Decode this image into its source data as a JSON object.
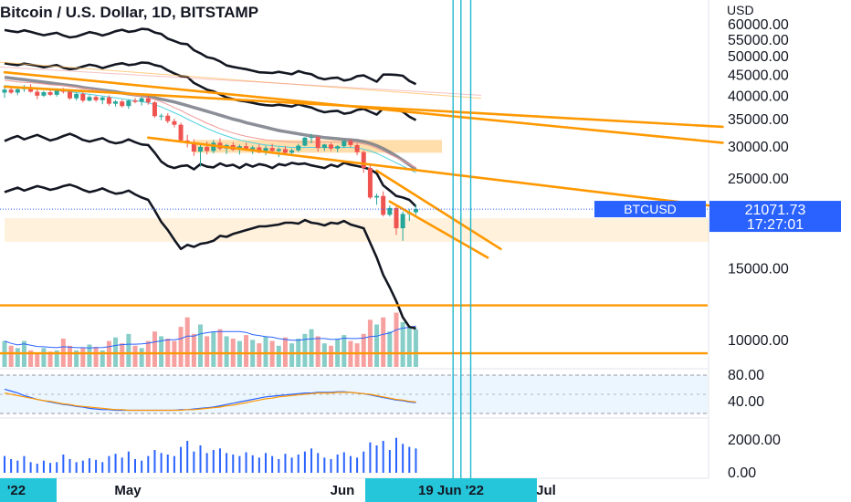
{
  "header": {
    "title": "Bitcoin / U.S. Dollar, 1D, BITSTAMP",
    "currency": "USD"
  },
  "price_tag": {
    "symbol": "BTCUSD",
    "price": "21071.73",
    "countdown": "17:27:01"
  },
  "colors": {
    "up": "#26a69a",
    "down": "#ef5350",
    "orange": "#ff9800",
    "cyan": "#22b8cf",
    "blue": "#2962ff",
    "grey": "#787b86"
  },
  "chart_data": {
    "type": "candlestick",
    "price_axis": {
      "ticks": [
        "60000.00",
        "55000.00",
        "50000.00",
        "45000.00",
        "40000.00",
        "35000.00",
        "30000.00",
        "25000.00",
        "15000.00",
        "10000.00"
      ],
      "tick_values": [
        60000,
        55000,
        50000,
        45000,
        40000,
        35000,
        30000,
        25000,
        15000,
        10000
      ]
    },
    "oscillator_axis": {
      "ticks": [
        "80.00",
        "40.00"
      ],
      "tick_values": [
        80,
        40
      ]
    },
    "volume_axis": {
      "ticks": [
        "2000.00",
        "0.00"
      ],
      "tick_values": [
        2000,
        0
      ]
    },
    "x_axis": {
      "labels": [
        "'22",
        "May",
        "Jun",
        "19 Jun '22",
        "Jul"
      ]
    },
    "candles_ohlc": [
      [
        40800,
        42200,
        39600,
        41500
      ],
      [
        41500,
        41900,
        40500,
        40800
      ],
      [
        40800,
        41800,
        40200,
        41600
      ],
      [
        41600,
        42600,
        41000,
        42100
      ],
      [
        42100,
        42800,
        40800,
        41000
      ],
      [
        41000,
        41600,
        39300,
        40100
      ],
      [
        40100,
        41200,
        39800,
        40900
      ],
      [
        40900,
        41400,
        40000,
        40300
      ],
      [
        40300,
        41800,
        39900,
        41400
      ],
      [
        41400,
        41900,
        40600,
        41000
      ],
      [
        41000,
        41300,
        39200,
        39500
      ],
      [
        39500,
        40800,
        39000,
        40500
      ],
      [
        40500,
        40900,
        38600,
        39000
      ],
      [
        39000,
        40200,
        38800,
        39800
      ],
      [
        39800,
        40100,
        38700,
        39100
      ],
      [
        39100,
        39900,
        38200,
        39700
      ],
      [
        39700,
        40200,
        37900,
        38300
      ],
      [
        38300,
        39100,
        37700,
        38800
      ],
      [
        38800,
        39200,
        37500,
        37800
      ],
      [
        37800,
        39300,
        37200,
        39000
      ],
      [
        39000,
        39600,
        38400,
        38700
      ],
      [
        38700,
        39900,
        37900,
        39500
      ],
      [
        39500,
        40100,
        38100,
        38600
      ],
      [
        38600,
        38900,
        35400,
        35700
      ],
      [
        35700,
        36200,
        34900,
        35800
      ],
      [
        35800,
        36300,
        34300,
        34700
      ],
      [
        34700,
        35200,
        33500,
        34000
      ],
      [
        34000,
        34400,
        30800,
        31100
      ],
      [
        31100,
        32100,
        29900,
        30600
      ],
      [
        30600,
        31300,
        28500,
        29200
      ],
      [
        29200,
        30300,
        26800,
        30000
      ],
      [
        30000,
        30900,
        28700,
        29300
      ],
      [
        29300,
        31200,
        28900,
        30700
      ],
      [
        30700,
        31500,
        29400,
        29700
      ],
      [
        29700,
        30500,
        28800,
        30300
      ],
      [
        30300,
        30800,
        29300,
        29500
      ],
      [
        29500,
        30400,
        28700,
        30100
      ],
      [
        30100,
        30700,
        29300,
        29400
      ],
      [
        29400,
        30200,
        28800,
        29900
      ],
      [
        29900,
        30400,
        28900,
        29100
      ],
      [
        29100,
        30200,
        28600,
        29800
      ],
      [
        29800,
        30500,
        29100,
        29300
      ],
      [
        29300,
        29900,
        28300,
        29600
      ],
      [
        29600,
        30100,
        28700,
        29000
      ],
      [
        29000,
        29700,
        28500,
        29400
      ],
      [
        29400,
        30500,
        29100,
        30200
      ],
      [
        30200,
        31700,
        30100,
        31600
      ],
      [
        31600,
        32300,
        30600,
        31700
      ],
      [
        31700,
        31900,
        29200,
        29800
      ],
      [
        29800,
        30500,
        29300,
        30400
      ],
      [
        30400,
        30700,
        29300,
        29700
      ],
      [
        29700,
        30300,
        29100,
        30100
      ],
      [
        30100,
        31200,
        29800,
        31000
      ],
      [
        31000,
        31400,
        29900,
        30300
      ],
      [
        30300,
        30600,
        28600,
        29100
      ],
      [
        29100,
        29400,
        25900,
        26600
      ],
      [
        26600,
        27200,
        22300,
        22500
      ],
      [
        22500,
        23000,
        21600,
        22700
      ],
      [
        22700,
        23300,
        20200,
        20400
      ],
      [
        20400,
        21500,
        20200,
        21200
      ],
      [
        21200,
        21400,
        18200,
        18900
      ],
      [
        18900,
        20800,
        17600,
        20500
      ],
      [
        20500,
        21100,
        19700,
        20700
      ],
      [
        20700,
        21600,
        20400,
        21071
      ]
    ],
    "band_series": {
      "upper_outer": [
        58200,
        57800,
        57500,
        58100,
        57600,
        57000,
        56500,
        56900,
        57300,
        56400,
        55800,
        56100,
        56800,
        57500,
        57100,
        56400,
        57000,
        57800,
        58300,
        57600,
        57900,
        58600,
        58400,
        57400,
        56900,
        55400,
        54700,
        53900,
        53700,
        51900,
        51000,
        49900,
        49500,
        48700,
        47600,
        47200,
        46900,
        46600,
        46200,
        45800,
        45700,
        45600,
        45900,
        45600,
        45300,
        46100,
        45600,
        45300,
        44400,
        44000,
        44300,
        44400,
        43700,
        44000,
        44800,
        45000,
        44200,
        43400,
        45200,
        45200,
        45100,
        44900,
        43600,
        42800
      ],
      "upper_inner": [
        48200,
        47900,
        47700,
        48100,
        47800,
        47500,
        47100,
        47400,
        47700,
        47000,
        46600,
        46800,
        47300,
        47800,
        47500,
        46900,
        47400,
        47900,
        48200,
        47700,
        47900,
        48400,
        48300,
        47700,
        47300,
        46300,
        45500,
        44800,
        44600,
        43100,
        42300,
        41500,
        41100,
        40400,
        39700,
        39300,
        39000,
        38800,
        38500,
        38200,
        38000,
        37900,
        38100,
        37900,
        37700,
        38200,
        37800,
        37500,
        36900,
        36500,
        36700,
        36800,
        36200,
        36400,
        37000,
        37200,
        36600,
        36000,
        37300,
        37200,
        37100,
        36600,
        35600,
        34900
      ],
      "lower_inner": [
        31000,
        31500,
        31900,
        31300,
        31700,
        32100,
        31600,
        31100,
        31400,
        31900,
        32300,
        31800,
        31200,
        30900,
        31200,
        31500,
        30900,
        30600,
        30800,
        31300,
        30800,
        30400,
        30300,
        29000,
        27600,
        26900,
        26600,
        26900,
        27000,
        26400,
        27200,
        26800,
        26700,
        27300,
        26900,
        27100,
        26600,
        27200,
        26800,
        27200,
        27000,
        26600,
        27200,
        27000,
        27400,
        27200,
        27300,
        27000,
        26800,
        26600,
        27100,
        26800,
        27400,
        27100,
        26900,
        26700,
        26400,
        25800,
        24100,
        23400,
        22700,
        22500,
        22200,
        21400
      ],
      "lower_outer": [
        23200,
        23500,
        23800,
        23400,
        23700,
        24000,
        23800,
        23500,
        23700,
        24000,
        24200,
        23900,
        23500,
        23200,
        23400,
        23700,
        23300,
        23000,
        23100,
        23400,
        22900,
        22500,
        22200,
        20900,
        19600,
        18700,
        17700,
        16800,
        17200,
        17000,
        17300,
        17400,
        17600,
        18100,
        18000,
        18300,
        18500,
        18700,
        18900,
        19100,
        19100,
        19200,
        19300,
        19500,
        19500,
        19400,
        19800,
        19500,
        19400,
        19200,
        19500,
        19400,
        19700,
        19300,
        19100,
        18900,
        17400,
        16000,
        14500,
        13500,
        12500,
        11400,
        10800,
        10700
      ]
    },
    "moving_averages": {
      "ma_grey": [
        44500,
        44300,
        44100,
        43900,
        43700,
        43500,
        43300,
        43100,
        42900,
        42700,
        42500,
        42300,
        42000,
        41800,
        41600,
        41400,
        41200,
        41000,
        40700,
        40500,
        40300,
        40100,
        39900,
        39600,
        39300,
        39000,
        38700,
        38300,
        37900,
        37500,
        37100,
        36700,
        36300,
        35900,
        35500,
        35100,
        34800,
        34400,
        34100,
        33800,
        33500,
        33200,
        32900,
        32700,
        32500,
        32300,
        32100,
        31900,
        31800,
        31600,
        31500,
        31400,
        31300,
        31200,
        31100,
        30900,
        30600,
        30200,
        29700,
        29100,
        28500,
        27800,
        27100,
        26400
      ],
      "ma_thin": [
        42500,
        42300,
        42100,
        42000,
        41900,
        41800,
        41600,
        41400,
        41300,
        41200,
        41000,
        40800,
        40600,
        40400,
        40200,
        40000,
        39800,
        39600,
        39400,
        39200,
        39000,
        38800,
        38500,
        38100,
        37600,
        37000,
        36400,
        35800,
        35100,
        34500,
        33900,
        33300,
        32800,
        32300,
        31900,
        31500,
        31200,
        30900,
        30700,
        30500,
        30300,
        30200,
        30100,
        30000,
        29900,
        29900,
        29900,
        29900,
        29900,
        29900,
        29900,
        29900,
        29900,
        29900,
        29800,
        29600,
        29300,
        28900,
        28400,
        27900,
        27400,
        26900,
        26400,
        25900
      ]
    },
    "trendlines": [
      {
        "from": [
          0,
          45800
        ],
        "to": [
          110,
          30700
        ]
      },
      {
        "from": [
          0,
          42200
        ],
        "to": [
          110,
          33600
        ]
      },
      {
        "from": [
          22,
          31600
        ],
        "to": [
          110,
          21300
        ]
      },
      {
        "from": [
          57,
          26200
        ],
        "to": [
          76,
          16800
        ]
      },
      {
        "from": [
          59,
          22000
        ],
        "to": [
          74,
          16000
        ]
      }
    ],
    "horizontal_levels": [
      12200,
      9300
    ],
    "zones": [
      {
        "from_index": 29,
        "to_index": 67,
        "low": 29000,
        "high": 31200
      },
      {
        "from_index": 0,
        "to_index": 110,
        "low": 17500,
        "high": 20000
      }
    ],
    "markers": [
      {
        "index": 60,
        "label": "19 Jun '22"
      }
    ],
    "volume": [
      1100,
      900,
      800,
      1100,
      700,
      600,
      800,
      650,
      700,
      1200,
      900,
      700,
      800,
      950,
      850,
      700,
      1100,
      1250,
      1000,
      1400,
      900,
      800,
      1100,
      1500,
      1300,
      1200,
      1100,
      1700,
      2100,
      1400,
      1800,
      1300,
      1500,
      1600,
      1300,
      1200,
      1100,
      1350,
      1150,
      1000,
      1300,
      1100,
      900,
      1250,
      1000,
      1200,
      1400,
      1600,
      1300,
      1000,
      900,
      1200,
      1350,
      1100,
      1000,
      1400,
      2000,
      1800,
      2100,
      1500,
      2300,
      1900,
      1700,
      1600
    ],
    "oscillator": {
      "stoch_k": [
        58,
        55,
        52,
        48,
        45,
        42,
        40,
        38,
        36,
        34,
        33,
        31,
        30,
        28,
        27,
        26,
        26,
        25,
        25,
        25,
        25,
        25,
        25,
        25,
        25,
        25,
        25,
        26,
        26,
        27,
        28,
        29,
        30,
        32,
        34,
        36,
        38,
        40,
        42,
        44,
        46,
        47,
        48,
        49,
        50,
        51,
        52,
        52,
        53,
        53,
        53,
        54,
        54,
        53,
        52,
        51,
        49,
        47,
        45,
        43,
        41,
        40,
        38,
        37
      ],
      "stoch_d": [
        52,
        50,
        48,
        46,
        44,
        42,
        40,
        39,
        37,
        35,
        34,
        32,
        31,
        30,
        29,
        28,
        27,
        26,
        26,
        25,
        25,
        25,
        25,
        25,
        25,
        25,
        25,
        25,
        26,
        26,
        27,
        28,
        29,
        30,
        32,
        33,
        35,
        37,
        39,
        41,
        43,
        44,
        46,
        47,
        48,
        49,
        50,
        51,
        52,
        52,
        52,
        53,
        53,
        53,
        52,
        51,
        50,
        48,
        46,
        44,
        42,
        41,
        39,
        38
      ]
    }
  }
}
